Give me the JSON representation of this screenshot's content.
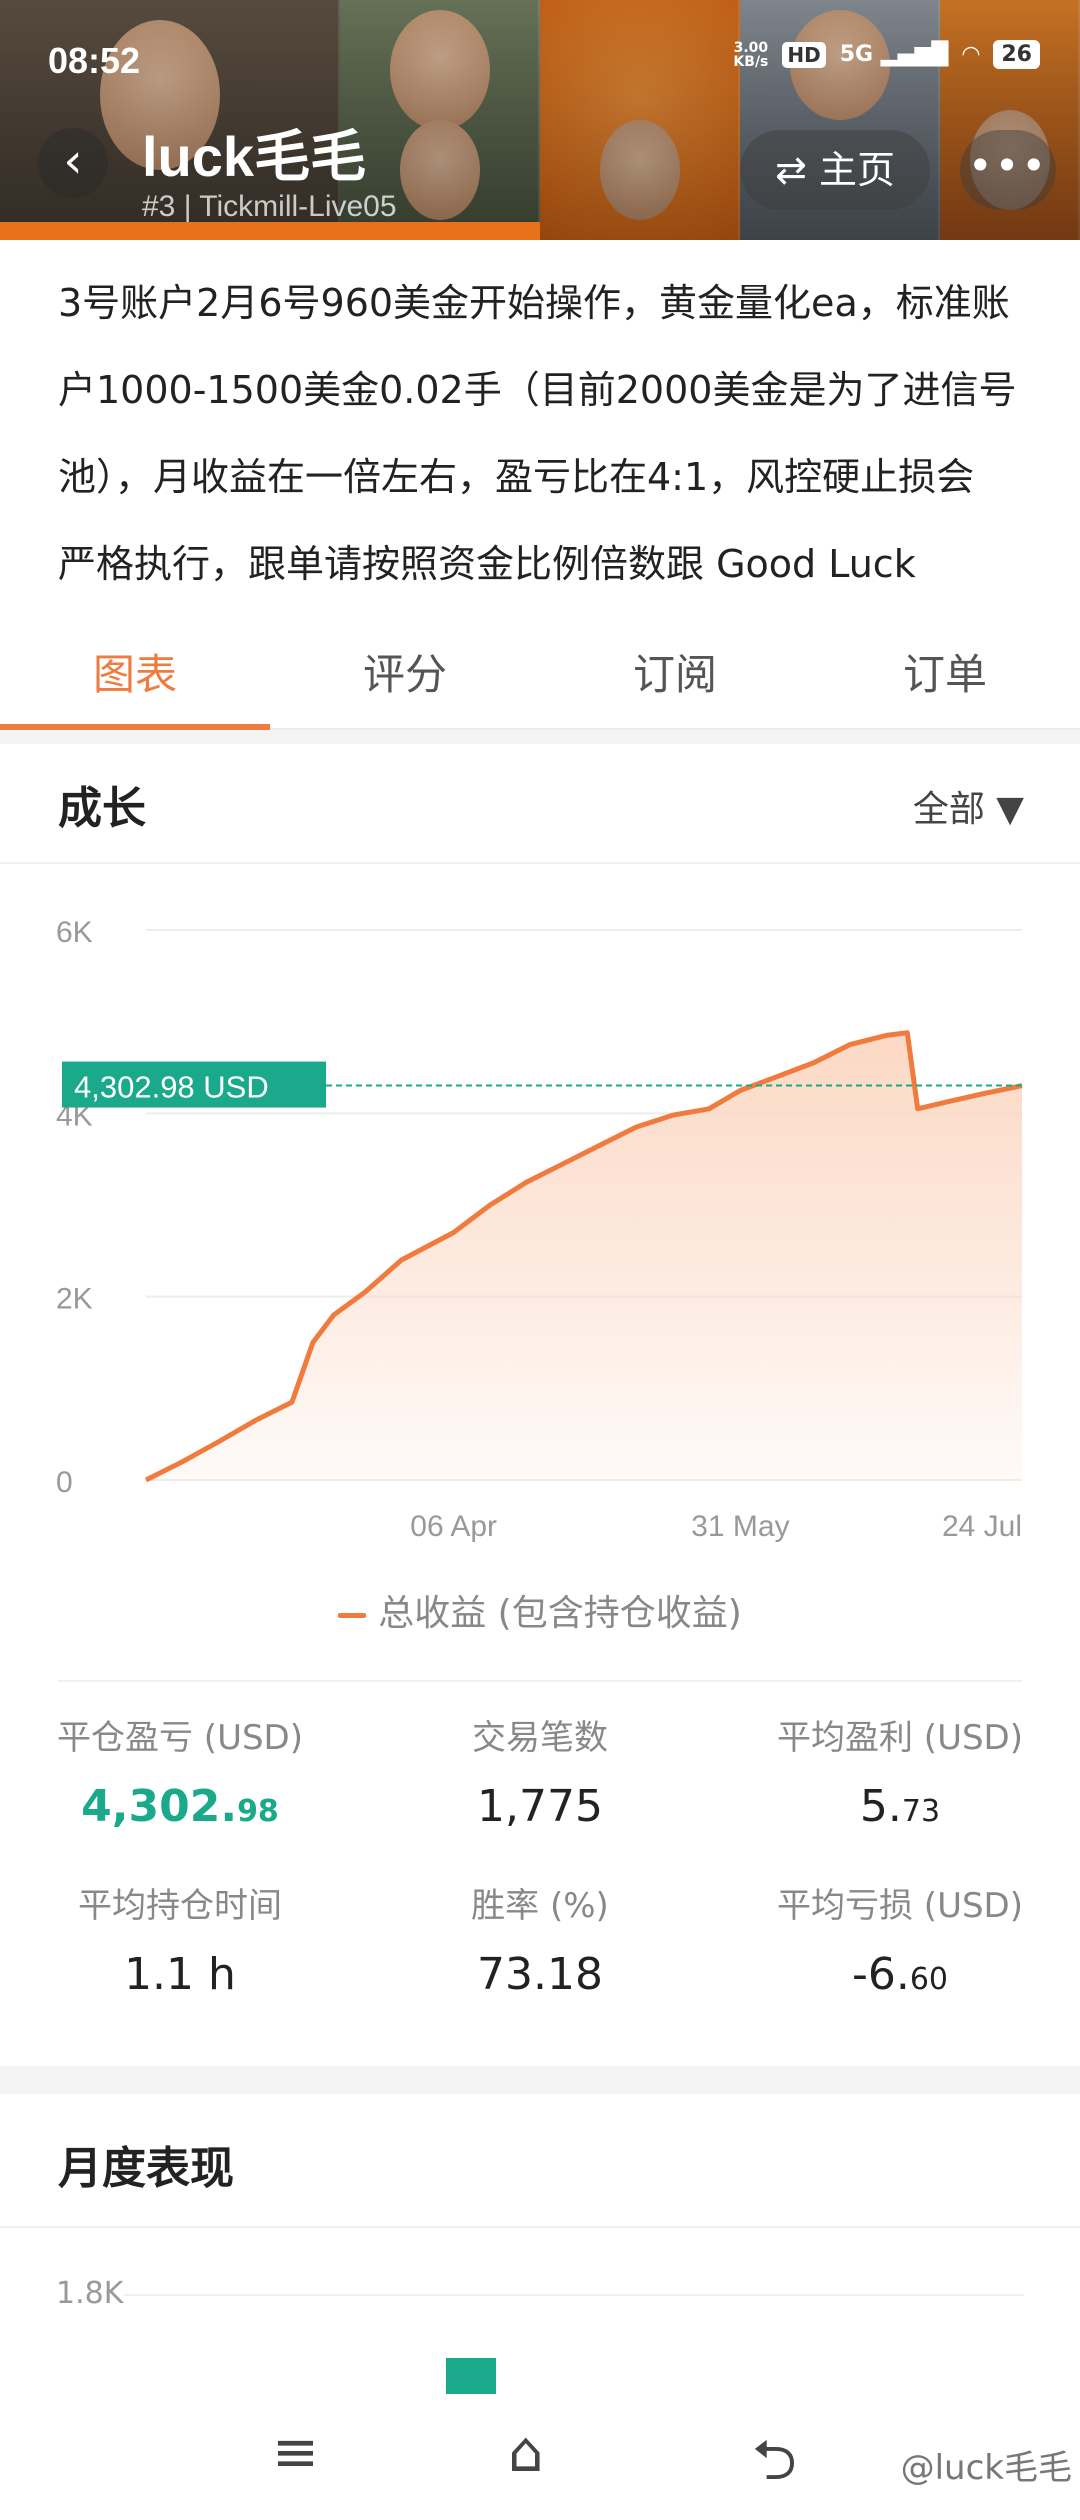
{
  "status": {
    "time": "08:52",
    "net_speed_top": "3.00",
    "net_speed_bottom": "KB/s",
    "hd": "HD",
    "signal": "5G",
    "battery": "26"
  },
  "profile": {
    "name": "luck毛毛",
    "subtitle": "#3 | Tickmill-Live05",
    "home_label": "⇄ 主页",
    "more_label": "•••"
  },
  "description": [
    "3号账户2月6号960美金开始操作，黄金量化ea，标准账",
    "户1000-1500美金0.02手（目前2000美金是为了进信号",
    "池），月收益在一倍左右，盈亏比在4:1，风控硬止损会",
    "严格执行，跟单请按照资金比例倍数跟 Good Luck"
  ],
  "tabs": [
    {
      "label": "图表",
      "active": true
    },
    {
      "label": "评分",
      "active": false
    },
    {
      "label": "订阅",
      "active": false
    },
    {
      "label": "订单",
      "active": false
    }
  ],
  "growth": {
    "title": "成长",
    "range": "全部 ▼",
    "legend": "总收益 (包含持仓收益)",
    "current_label": "4,302.98 USD"
  },
  "chart_data": {
    "type": "area",
    "title": "成长",
    "y_ticks": [
      "0",
      "2K",
      "4K",
      "6K"
    ],
    "ylim": [
      0,
      6000
    ],
    "x_ticks": [
      "06 Apr",
      "31 May",
      "24 Jul"
    ],
    "series": [
      {
        "name": "总收益 (包含持仓收益)",
        "x": [
          "2025-02-06",
          "2025-02-13",
          "2025-02-20",
          "2025-02-27",
          "2025-03-06",
          "2025-03-10",
          "2025-03-14",
          "2025-03-20",
          "2025-03-27",
          "2025-04-06",
          "2025-04-13",
          "2025-04-20",
          "2025-04-27",
          "2025-05-04",
          "2025-05-11",
          "2025-05-18",
          "2025-05-25",
          "2025-05-31",
          "2025-06-07",
          "2025-06-14",
          "2025-06-21",
          "2025-06-28",
          "2025-07-02",
          "2025-07-04",
          "2025-07-10",
          "2025-07-17",
          "2025-07-24"
        ],
        "values": [
          0,
          200,
          420,
          650,
          850,
          1500,
          1800,
          2050,
          2400,
          2700,
          3000,
          3250,
          3450,
          3650,
          3850,
          3980,
          4050,
          4250,
          4400,
          4550,
          4750,
          4850,
          4880,
          4050,
          4130,
          4220,
          4302.98
        ]
      }
    ],
    "reference_line": 4302.98,
    "colors": {
      "line": "#f07b3f",
      "fill": "#fbd6c1",
      "reference": "#1aa98a"
    }
  },
  "stats": [
    {
      "label": "平仓盈亏 (USD)",
      "main": "4,302.",
      "small": ".98",
      "green": true
    },
    {
      "label": "交易笔数",
      "main": "1,775",
      "small": ""
    },
    {
      "label": "平均盈利 (USD)",
      "main": "5.",
      "small": "73"
    },
    {
      "label": "平均持仓时间",
      "main": "1.1 h",
      "small": ""
    },
    {
      "label": "胜率 (%)",
      "main": "73.18",
      "small": ""
    },
    {
      "label": "平均亏损 (USD)",
      "main": "-6.",
      "small": "60"
    }
  ],
  "monthly": {
    "title": "月度表现",
    "y_tick": "1.8K"
  },
  "navbar": {
    "menu": "≡",
    "home": "⌂",
    "back": "⮌",
    "watermark": "@luck毛毛"
  }
}
